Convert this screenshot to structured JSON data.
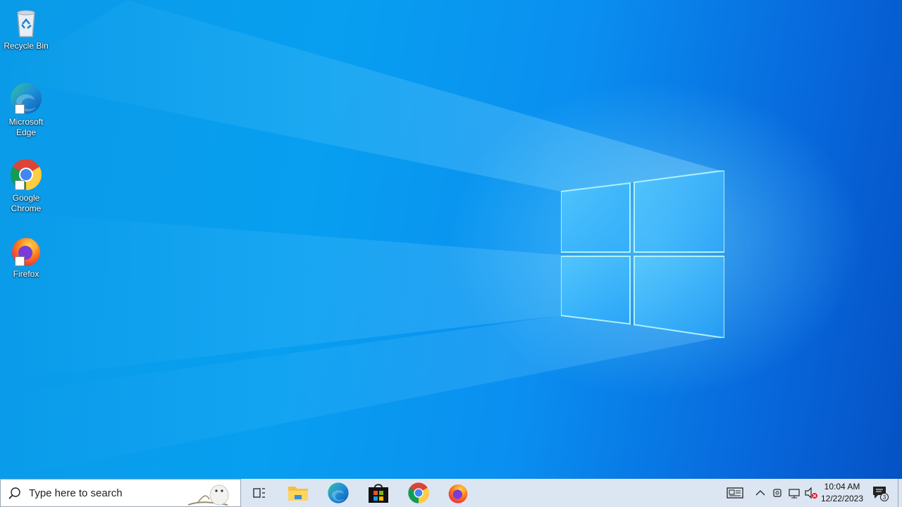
{
  "desktop": {
    "icons": [
      {
        "label": "Recycle Bin",
        "icon": "recycle-bin-icon"
      },
      {
        "label": "Microsoft Edge",
        "icon": "edge-icon"
      },
      {
        "label": "Google Chrome",
        "icon": "chrome-icon"
      },
      {
        "label": "Firefox",
        "icon": "firefox-icon"
      }
    ]
  },
  "taskbar": {
    "search": {
      "placeholder": "Type here to search"
    },
    "pinned": [
      {
        "name": "Task View",
        "icon": "task-view-icon"
      },
      {
        "name": "File Explorer",
        "icon": "folder-icon"
      },
      {
        "name": "Microsoft Edge",
        "icon": "edge-icon"
      },
      {
        "name": "Microsoft Store",
        "icon": "store-icon"
      },
      {
        "name": "Google Chrome",
        "icon": "chrome-icon"
      },
      {
        "name": "Firefox",
        "icon": "firefox-icon"
      }
    ],
    "tray": {
      "time": "10:04 AM",
      "date": "12/22/2023",
      "notification_count": "3"
    }
  },
  "colors": {
    "wallpaper_light": "#1aa7f0",
    "wallpaper_dark": "#0552c4",
    "taskbar_bg": "#dce6f2"
  }
}
